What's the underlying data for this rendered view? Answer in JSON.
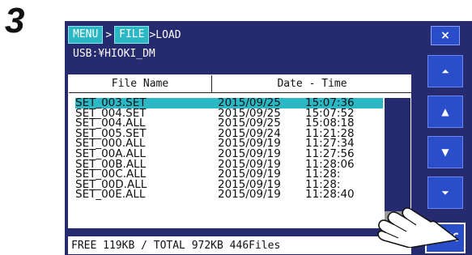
{
  "step": "3",
  "breadcrumb": {
    "menu": "MENU",
    "file": "FILE",
    "load": ">LOAD"
  },
  "close_label": "×",
  "path": "USB:¥HIOKI_DM",
  "columns": {
    "name": "File Name",
    "datetime": "Date - Time"
  },
  "files": [
    {
      "name": "SET_003.SET",
      "date": "2015/09/25",
      "time": "15:07:36"
    },
    {
      "name": "SET_004.SET",
      "date": "2015/09/25",
      "time": "15:07:52"
    },
    {
      "name": "SET_004.ALL",
      "date": "2015/09/25",
      "time": "15:08:18"
    },
    {
      "name": "SET_005.SET",
      "date": "2015/09/24",
      "time": "11:21:28"
    },
    {
      "name": "SET_000.ALL",
      "date": "2015/09/19",
      "time": "11:27:34"
    },
    {
      "name": "SET_00A.ALL",
      "date": "2015/09/19",
      "time": "11:27:56"
    },
    {
      "name": "SET_00B.ALL",
      "date": "2015/09/19",
      "time": "11:28:06"
    },
    {
      "name": "SET_00C.ALL",
      "date": "2015/09/19",
      "time": "11:28:"
    },
    {
      "name": "SET_00D.ALL",
      "date": "2015/09/19",
      "time": "11:28:"
    },
    {
      "name": "SET_00E.ALL",
      "date": "2015/09/19",
      "time": "11:28:40"
    }
  ],
  "selected_index": 0,
  "status": "FREE 119KB / TOTAL 972KB 446Files",
  "buttons": {
    "top": "⏶",
    "up": "▲",
    "down": "▼",
    "bottom": "⏷",
    "exec": "EXEC"
  },
  "colors": {
    "frame": "#262a6e",
    "accent": "#2bb7c4",
    "button": "#2a4dc9"
  }
}
